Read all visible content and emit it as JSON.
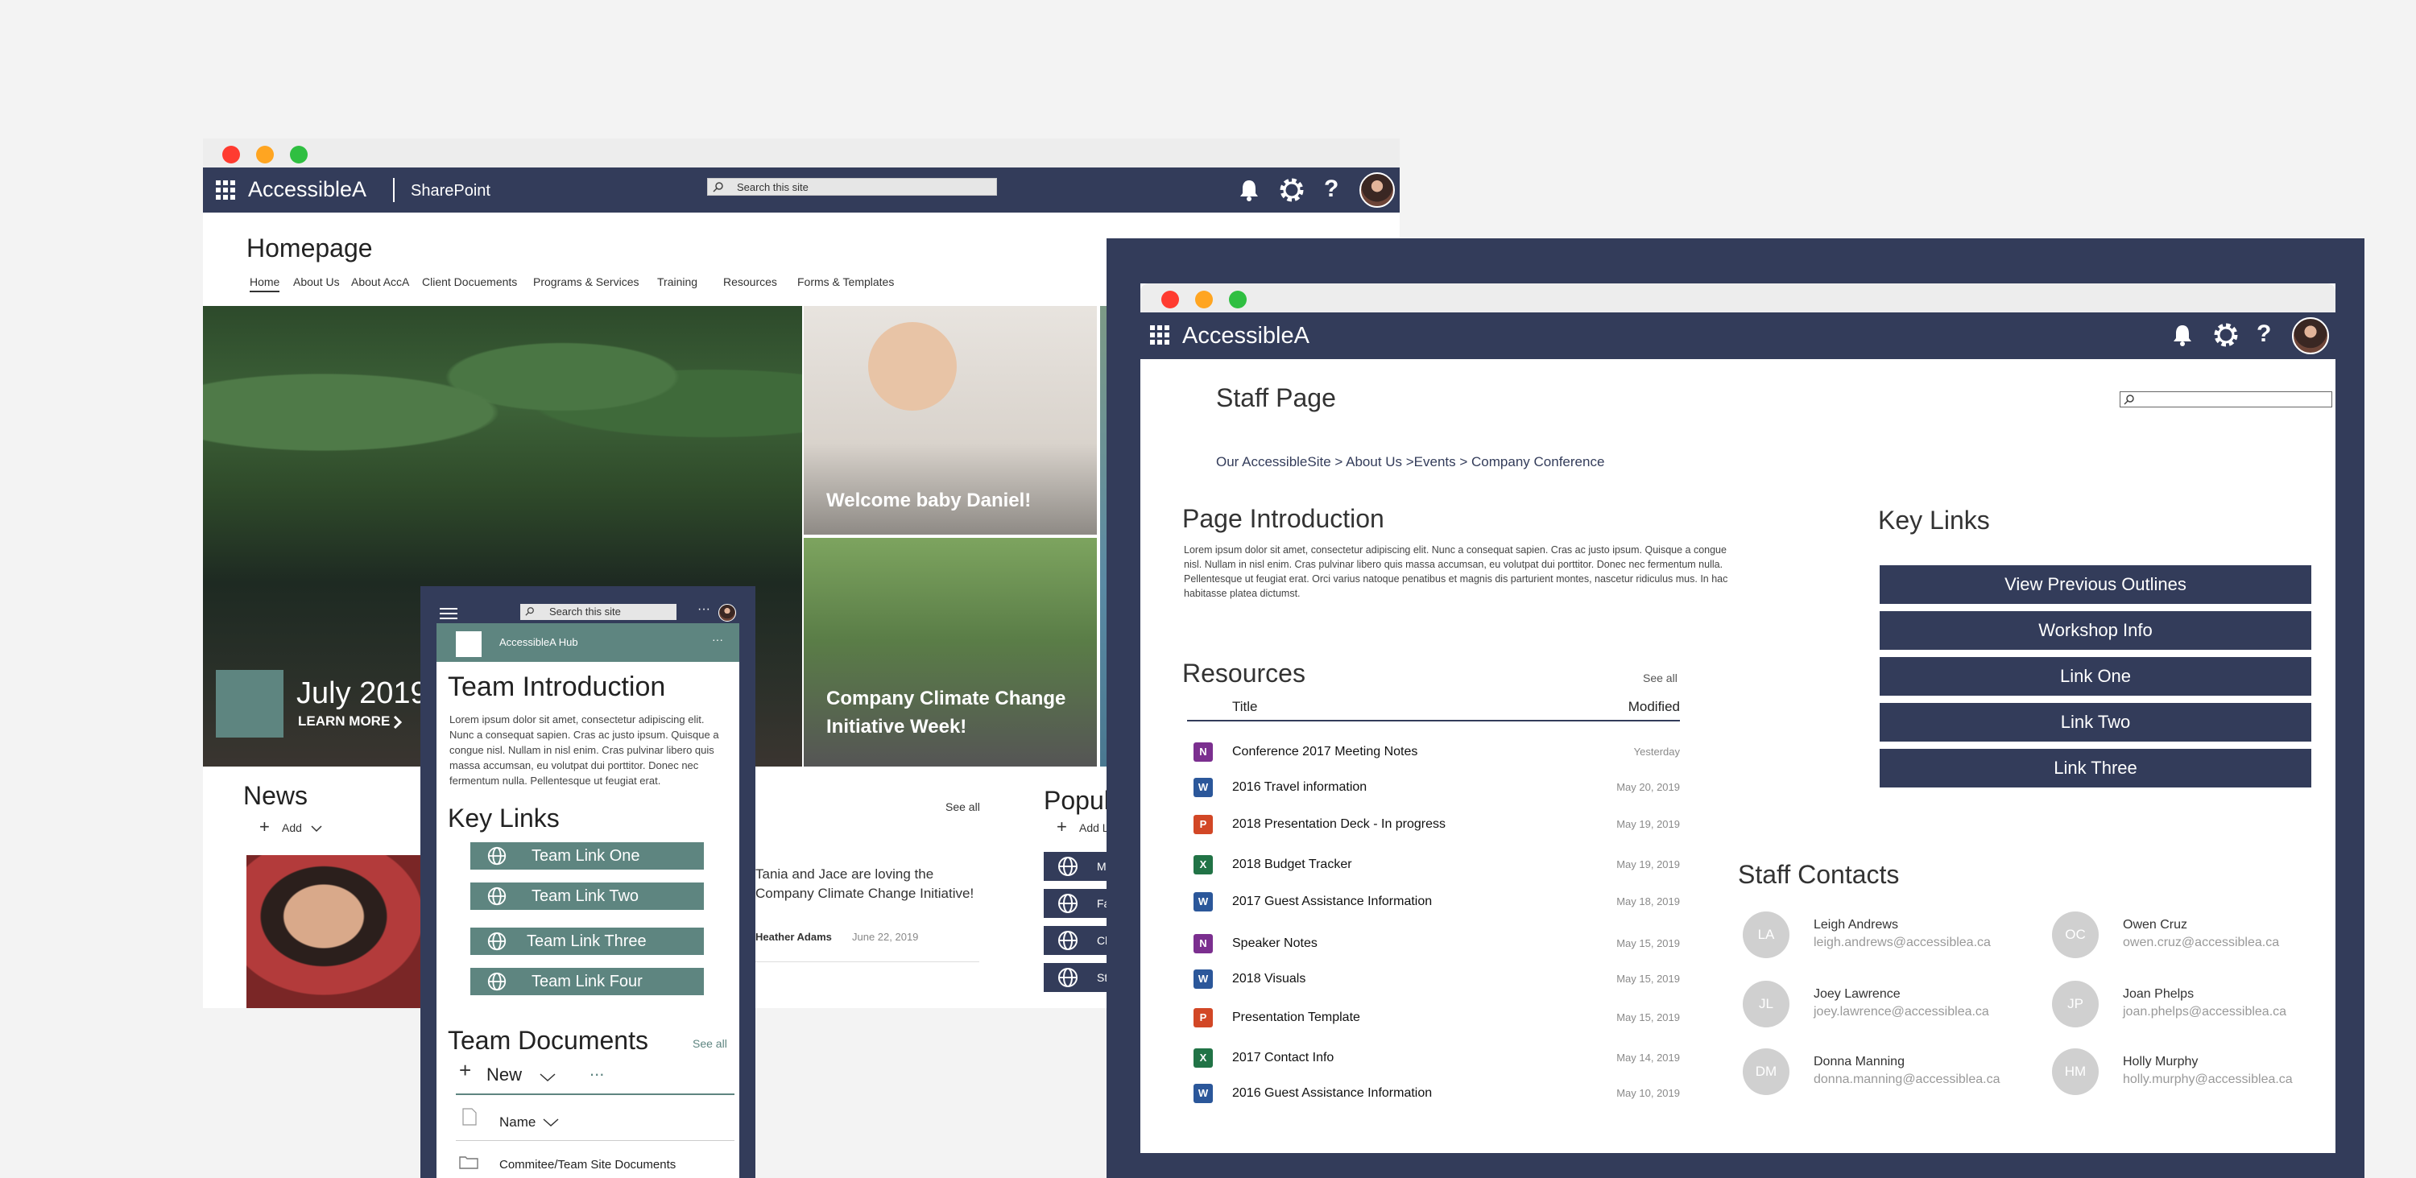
{
  "back_window": {
    "brand": "AccessibleA",
    "app_name": "SharePoint",
    "search_placeholder": "Search this site",
    "page_title": "Homepage",
    "nav": [
      "Home",
      "About Us",
      "About AccA",
      "Client Docuements",
      "Programs & Services",
      "Training",
      "Resources",
      "Forms & Templates"
    ],
    "hero_main": {
      "title": "July 2019 I",
      "cta": "LEARN MORE"
    },
    "hero_tiles": [
      "Welcome baby Daniel!",
      "Company Climate Change Initiative Week!"
    ],
    "news": {
      "heading": "News",
      "add_label": "Add",
      "see_all": "See all",
      "item_text": "Tania and Jace are loving the Company Climate Change Initiative!",
      "author": "Heather Adams",
      "date": "June 22, 2019"
    },
    "popular": {
      "heading": "Popul",
      "add_label": "Add L",
      "items": [
        "M",
        "Fa",
        "Cl",
        "St"
      ]
    }
  },
  "phone": {
    "search_placeholder": "Search this site",
    "hub_name": "AccessibleA Hub",
    "team_intro_heading": "Team Introduction",
    "team_intro_body": "Lorem ipsum dolor sit amet, consectetur adipiscing elit. Nunc a consequat sapien. Cras ac justo ipsum. Quisque a congue nisl. Nullam in nisl enim. Cras pulvinar libero quis massa accumsan, eu volutpat dui porttitor. Donec nec fermentum nulla. Pellentesque ut feugiat erat.",
    "key_links_heading": "Key Links",
    "key_links": [
      "Team Link One",
      "Team Link Two",
      "Team Link Three",
      "Team Link Four"
    ],
    "docs_heading": "Team Documents",
    "docs_see_all": "See all",
    "new_label": "New",
    "more_label": "...",
    "name_header": "Name",
    "folder_item": "Commitee/Team Site Documents"
  },
  "front_window": {
    "brand": "AccessibleA",
    "page_title": "Staff Page",
    "breadcrumb": "Our AccessibleSite > About Us >Events > Company Conference",
    "intro_heading": "Page Introduction",
    "intro_body": "Lorem ipsum dolor sit amet, consectetur adipiscing elit. Nunc a consequat sapien. Cras ac justo ipsum. Quisque a congue nisl. Nullam in nisl enim. Cras pulvinar libero quis massa accumsan, eu volutpat dui porttitor. Donec nec fermentum nulla. Pellentesque ut feugiat erat. Orci varius natoque penatibus et magnis dis parturient montes, nascetur ridiculus mus. In hac habitasse platea dictumst.",
    "key_links_heading": "Key Links",
    "key_links": [
      "View Previous Outlines",
      "Workshop Info",
      "Link One",
      "Link Two",
      "Link Three"
    ],
    "resources": {
      "heading": "Resources",
      "see_all": "See all",
      "col_title": "Title",
      "col_modified": "Modified",
      "rows": [
        {
          "type": "N",
          "color": "#7b2f8f",
          "title": "Conference 2017 Meeting Notes",
          "modified": "Yesterday"
        },
        {
          "type": "W",
          "color": "#2b579a",
          "title": "2016 Travel information",
          "modified": "May 20, 2019"
        },
        {
          "type": "P",
          "color": "#d24726",
          "title": "2018 Presentation Deck - In progress",
          "modified": "May 19, 2019"
        },
        {
          "type": "X",
          "color": "#217346",
          "title": "2018 Budget Tracker",
          "modified": "May 19, 2019"
        },
        {
          "type": "W",
          "color": "#2b579a",
          "title": "2017 Guest Assistance Information",
          "modified": "May 18, 2019"
        },
        {
          "type": "N",
          "color": "#7b2f8f",
          "title": "Speaker Notes",
          "modified": "May 15, 2019"
        },
        {
          "type": "W",
          "color": "#2b579a",
          "title": "2018 Visuals",
          "modified": "May 15, 2019"
        },
        {
          "type": "P",
          "color": "#d24726",
          "title": "Presentation Template",
          "modified": "May 15, 2019"
        },
        {
          "type": "X",
          "color": "#217346",
          "title": "2017 Contact Info",
          "modified": "May 14, 2019"
        },
        {
          "type": "W",
          "color": "#2b579a",
          "title": "2016 Guest Assistance Information",
          "modified": "May 10, 2019"
        }
      ]
    },
    "staff_contacts": {
      "heading": "Staff Contacts",
      "people": [
        {
          "initials": "LA",
          "name": "Leigh Andrews",
          "email": "leigh.andrews@accessiblea.ca"
        },
        {
          "initials": "OC",
          "name": "Owen Cruz",
          "email": "owen.cruz@accessiblea.ca"
        },
        {
          "initials": "JL",
          "name": "Joey Lawrence",
          "email": "joey.lawrence@accessiblea.ca"
        },
        {
          "initials": "JP",
          "name": "Joan Phelps",
          "email": "joan.phelps@accessiblea.ca"
        },
        {
          "initials": "DM",
          "name": "Donna Manning",
          "email": "donna.manning@accessiblea.ca"
        },
        {
          "initials": "HM",
          "name": "Holly Murphy",
          "email": "holly.murphy@accessiblea.ca"
        }
      ]
    }
  },
  "colors": {
    "navy": "#333c5a",
    "teal": "#5e8580",
    "page_bg": "#f3f3f3"
  }
}
